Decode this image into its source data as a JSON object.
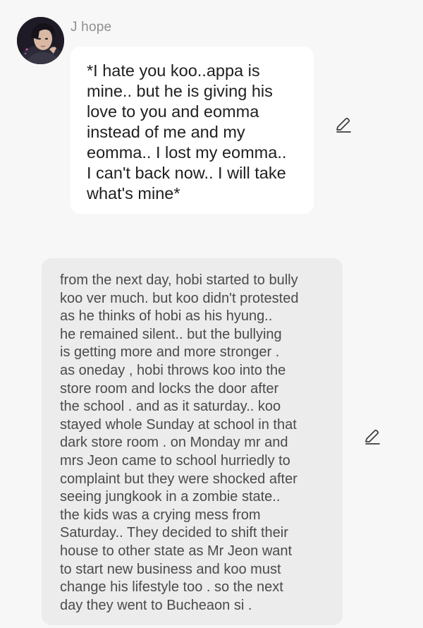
{
  "message": {
    "sender_name": "J hope",
    "text": "*I hate you koo..appa is\nmine.. but he is giving his\nlove to you and eomma\ninstead of me and my\neomma.. I lost my eomma..\nI can't back now.. I will take\nwhat's mine*"
  },
  "narration": {
    "text": "from the next day, hobi started to bully\nkoo ver much.  but koo didn't protested\nas he thinks of hobi as his hyung..\nhe remained silent.. but the bullying\nis getting more and more stronger .\nas oneday , hobi throws koo into the\nstore room and locks the door after\nthe school . and as it saturday.. koo\nstayed whole Sunday at school in that\ndark store room . on Monday mr and\nmrs Jeon came to school hurriedly to\ncomplaint but they were shocked after\nseeing jungkook in a zombie state..\nthe kids was a crying mess from\nSaturday.. They decided to shift their\nhouse to other state as Mr Jeon want\nto start new business and koo must\nchange his lifestyle too . so the next\nday they went to Bucheaon si ."
  },
  "icons": {
    "edit": "pencil-edit-icon",
    "avatar": "avatar-photo"
  },
  "colors": {
    "background": "#f7f7f7",
    "message_bubble": "#ffffff",
    "narration_bubble": "#ececec",
    "message_text": "#1f1f1f",
    "narration_text": "#4b4b4b",
    "sender_name": "#8e8e8e"
  }
}
